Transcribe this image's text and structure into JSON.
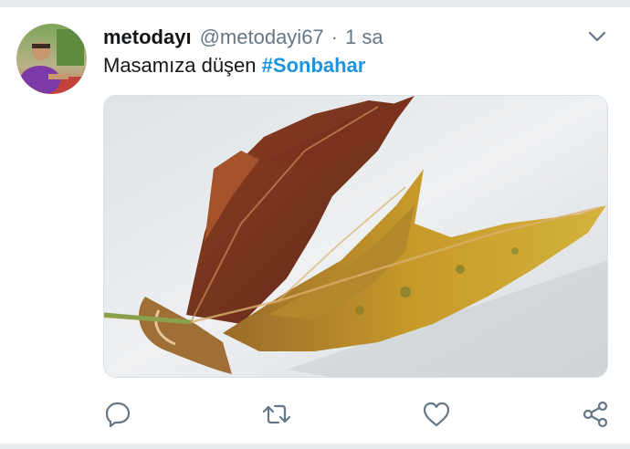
{
  "tweet": {
    "author_name": "metodayı",
    "author_handle": "@metodayi67",
    "separator": "·",
    "time": "1 sa",
    "text": "Masamıza düşen",
    "hashtag": "#Sonbahar"
  },
  "icons": {
    "caret": "chevron-down-icon",
    "reply": "reply-icon",
    "retweet": "retweet-icon",
    "like": "heart-icon",
    "share": "share-icon"
  },
  "colors": {
    "text": "#14171a",
    "secondary": "#657786",
    "link": "#1b95e0",
    "icon": "#657786"
  }
}
